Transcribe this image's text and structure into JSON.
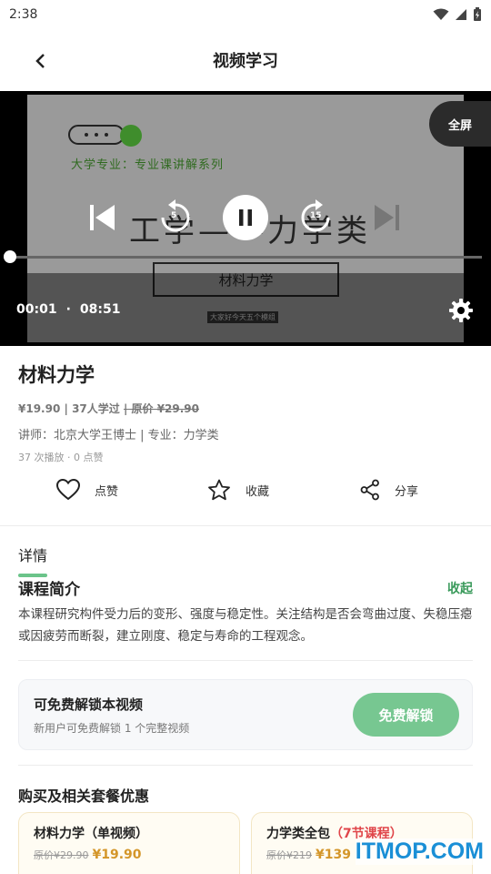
{
  "status_bar": {
    "time": "2:38"
  },
  "app_bar": {
    "title": "视频学习",
    "back_icon": "‹"
  },
  "player": {
    "fullscreen_label": "全屏",
    "current_time": "00:01",
    "separator": "·",
    "duration": "08:51",
    "progress": 0.002,
    "rewind_seconds": "5",
    "forward_seconds": "15",
    "slide": {
      "subtitle": "大学专业：专业课讲解系列",
      "title": "工学——力学类",
      "box_text": "材料力学",
      "tiny_text": "大家好今天五个模组"
    }
  },
  "course": {
    "title": "材料力学",
    "price": "¥19.90",
    "learners": "37人学过",
    "original_price": "原价 ¥29.90",
    "lecturer": "讲师：北京大学王博士",
    "major": "专业：力学类",
    "stats": "37 次播放 · 0 点赞"
  },
  "actions": {
    "like": "点赞",
    "favorite": "收藏",
    "share": "分享"
  },
  "detail": {
    "label": "详情",
    "intro_title": "课程简介",
    "collapse": "收起",
    "intro_text": "本课程研究构件受力后的变形、强度与稳定性。关注结构是否会弯曲过度、失稳压瘪或因疲劳而断裂，建立刚度、稳定与寿命的工程观念。"
  },
  "unlock": {
    "title": "可免费解锁本视频",
    "subtitle": "新用户可免费解锁 1 个完整视频",
    "button": "免费解锁"
  },
  "bundles": {
    "heading": "购买及相关套餐优惠",
    "items": [
      {
        "name": "材料力学（单视频）",
        "count": "",
        "old_price": "原价¥29.90",
        "new_price": "¥19.90"
      },
      {
        "name": "力学类全包",
        "count": "（7节课程）",
        "old_price": "原价¥219",
        "new_price": "¥139"
      }
    ]
  },
  "watermark": "ITMOP.COM",
  "colors": {
    "accent": "#77c791",
    "link": "#3a9a5b",
    "price": "#d4962a"
  }
}
